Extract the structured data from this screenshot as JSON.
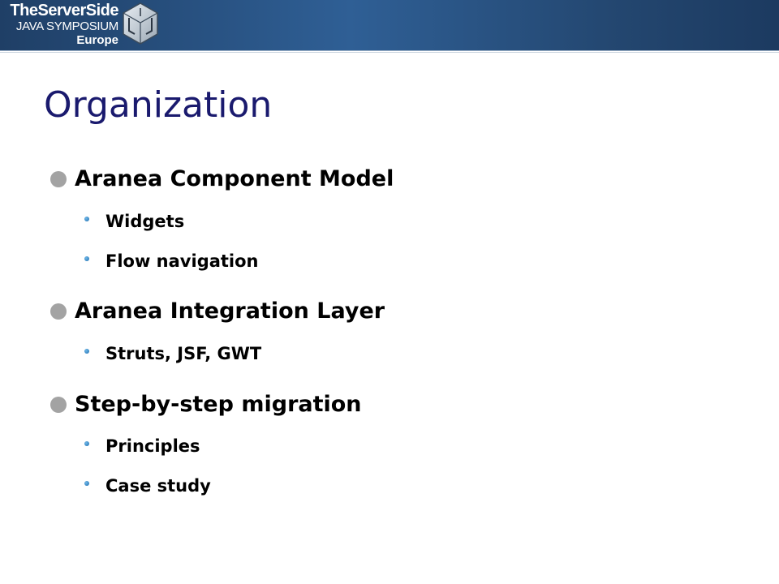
{
  "header": {
    "logo_line1": "TheServerSide",
    "logo_line2": "JAVA SYMPOSIUM",
    "logo_line3": "Europe",
    "logo_icon": "cube-logo-icon",
    "colors": {
      "bar": "#2f5f95",
      "title": "#1a1a6e",
      "bullet_primary": "#a3a3a3",
      "bullet_secondary": "#1e6fb0"
    }
  },
  "slide": {
    "title": "Organization",
    "bullets": [
      {
        "text": "Aranea Component Model",
        "sub": [
          "Widgets",
          "Flow navigation"
        ]
      },
      {
        "text": "Aranea Integration Layer",
        "sub": [
          "Struts, JSF, GWT"
        ]
      },
      {
        "text": "Step-by-step migration",
        "sub": [
          "Principles",
          "Case study"
        ]
      }
    ]
  }
}
